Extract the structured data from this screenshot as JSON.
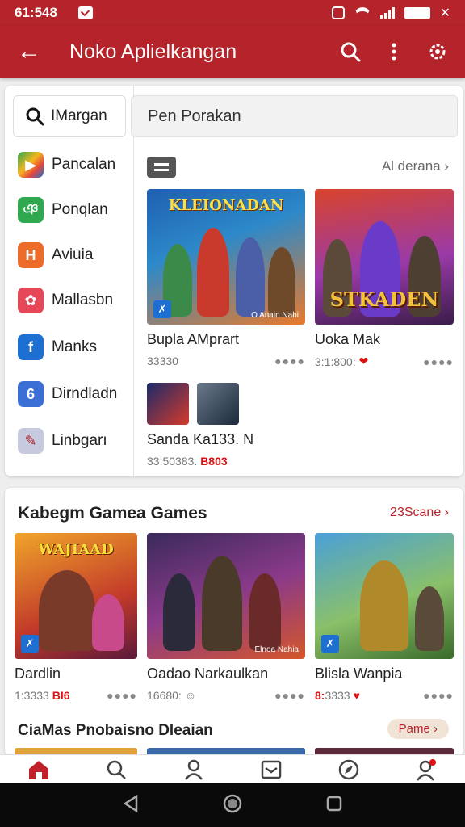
{
  "status_bar": {
    "time": "61:548"
  },
  "app_bar": {
    "title": "Noko Aplielkangan"
  },
  "sidebar": {
    "search_label": "IMargan",
    "items": [
      {
        "label": "Pancalan",
        "icon": "play-store-icon",
        "color": "#e5483d"
      },
      {
        "label": "Ponqlan",
        "icon": "app-icon",
        "color": "#2fa84f"
      },
      {
        "label": "Aviuia",
        "icon": "h-icon",
        "color": "#ee6c2a"
      },
      {
        "label": "Mallasbn",
        "icon": "rose-icon",
        "color": "#e6485a"
      },
      {
        "label": "Manks",
        "icon": "facebook-icon",
        "color": "#1d6fd1"
      },
      {
        "label": "Dirndladn",
        "icon": "swirl-icon",
        "color": "#3b6fd6"
      },
      {
        "label": "Linbgarı",
        "icon": "tool-icon",
        "color": "#c7c9de"
      }
    ]
  },
  "search": {
    "placeholder": "Pen Porakan"
  },
  "featured": {
    "see_all": "Al derana",
    "cards": [
      {
        "art_title": "KLEIONADAN",
        "art_caption": "O Anain Nahi",
        "name": "Bupla AMprart",
        "meta": "33330"
      },
      {
        "art_title": "STKADEN",
        "art_caption": "",
        "name": "Uoka Mak",
        "meta": "3:1:800:"
      },
      {
        "name": "Sanda Ka133. N",
        "meta": "33:50383.",
        "tag": "B803"
      }
    ]
  },
  "games": {
    "title": "Kabegm Gamea Games",
    "link": "23Scane",
    "cards": [
      {
        "art_title": "WAJIAAD",
        "name": "Dardlin",
        "meta": "1:3333",
        "tag": "BI6"
      },
      {
        "art_title": "",
        "art_caption": "Elnoa Nahia",
        "name": "Oadao Narkaulkan",
        "meta": "16680:"
      },
      {
        "art_title": "",
        "name": "Blisla Wanpia",
        "meta": "3333",
        "prefix": "8:"
      }
    ]
  },
  "section3": {
    "title": "CiaMas Pnobaisno Dleaian",
    "chip": "Pame"
  }
}
